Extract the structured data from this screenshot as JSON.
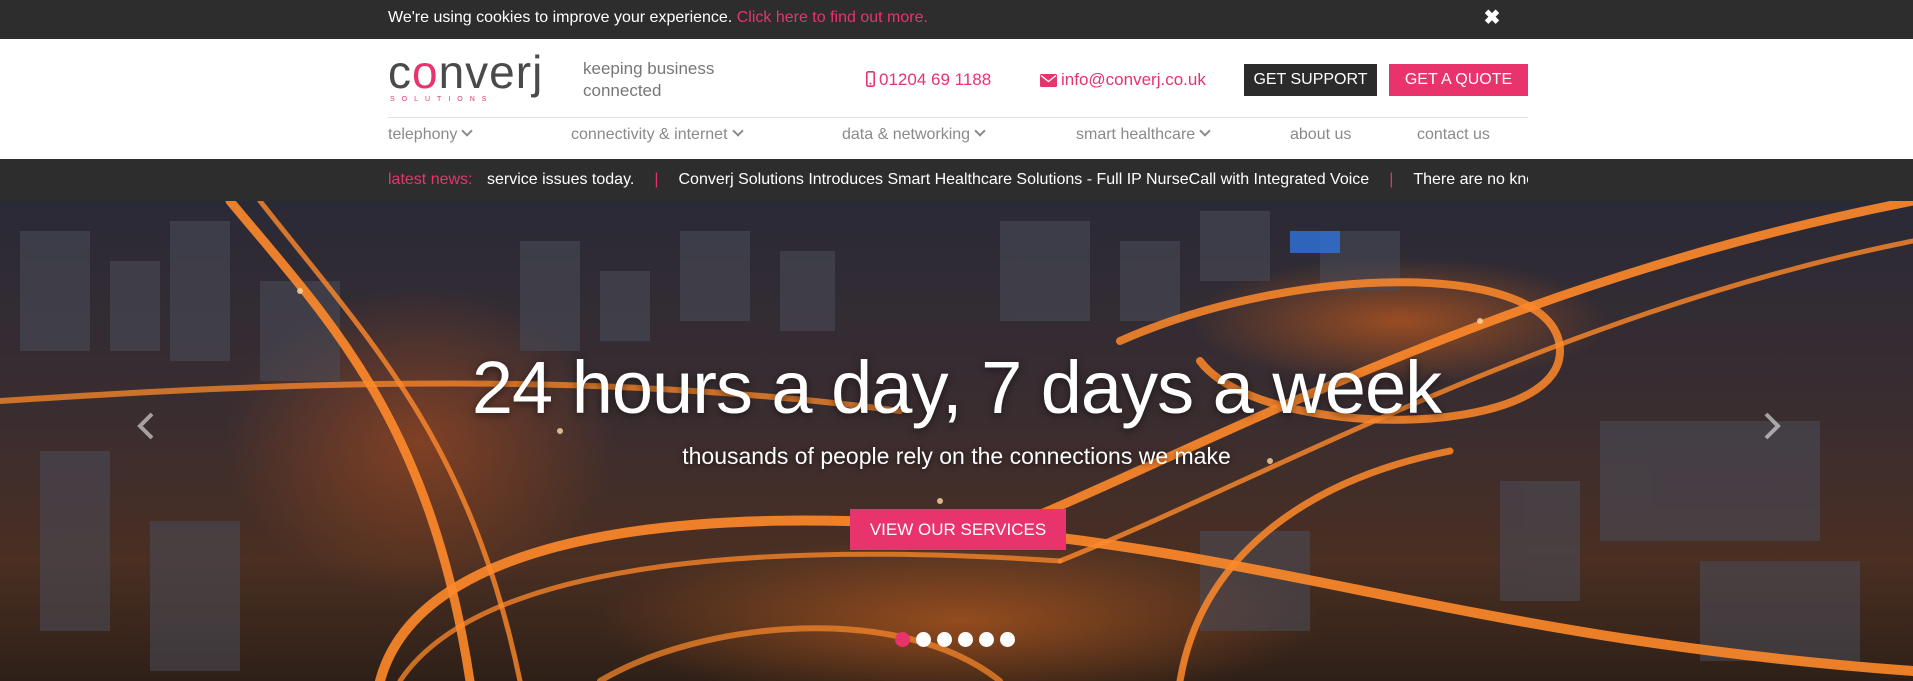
{
  "cookie": {
    "message": "We're using cookies to improve your experience.",
    "link": "Click here to find out more.",
    "close_icon": "close-icon"
  },
  "header": {
    "logo_text_pre": "c",
    "logo_text_o": "o",
    "logo_text_post": "nverj",
    "logo_sub": "SOLUTIONS",
    "tagline": "keeping business connected",
    "phone": "01204 69 1188",
    "email": "info@converj.co.uk",
    "support_label": "GET SUPPORT",
    "quote_label": "GET A QUOTE"
  },
  "nav": {
    "items": [
      {
        "label": "telephony",
        "dropdown": true
      },
      {
        "label": "connectivity & internet",
        "dropdown": true
      },
      {
        "label": "data & networking",
        "dropdown": true
      },
      {
        "label": "smart healthcare",
        "dropdown": true
      },
      {
        "label": "about us",
        "dropdown": false
      },
      {
        "label": "contact us",
        "dropdown": false
      }
    ]
  },
  "news": {
    "label": "latest news:",
    "items": [
      "service issues today.",
      "Converj Solutions Introduces Smart Healthcare Solutions - Full IP NurseCall with Integrated Voice",
      "There are no known"
    ],
    "separator": "|"
  },
  "hero": {
    "title": "24 hours a day, 7 days a week",
    "subtitle": "thousands of people rely on the connections we make",
    "button": "VIEW OUR SERVICES",
    "slides_total": 6,
    "active_slide": 1
  },
  "colors": {
    "accent": "#e8336d",
    "dark_bar": "#2d2d2d",
    "nav_text": "#8a8a8a"
  }
}
